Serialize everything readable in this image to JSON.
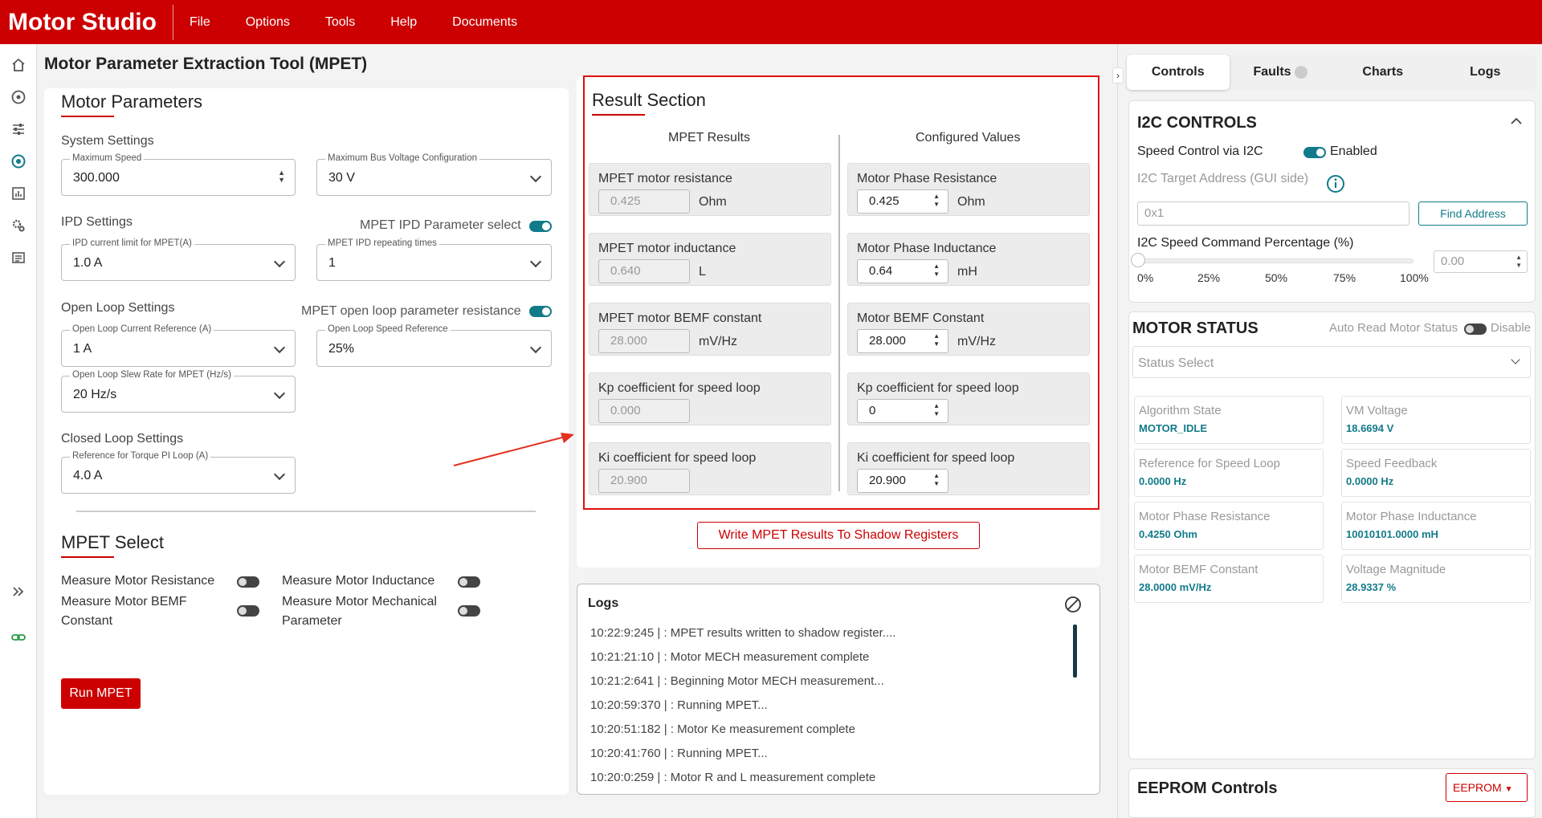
{
  "app": {
    "brand": "Motor Studio",
    "menu": [
      "File",
      "Options",
      "Tools",
      "Help",
      "Documents"
    ]
  },
  "page_title": "Motor Parameter Extraction Tool (MPET)",
  "motor_params": {
    "title": "Motor Parameters",
    "system_settings": "System Settings",
    "max_speed": {
      "label": "Maximum Speed",
      "value": "300.000"
    },
    "max_bus_voltage": {
      "label": "Maximum Bus Voltage Configuration",
      "value": "30 V"
    },
    "ipd_settings": "IPD Settings",
    "ipd_param_select": "MPET IPD Parameter select",
    "ipd_current": {
      "label": "IPD current limit for MPET(A)",
      "value": "1.0 A"
    },
    "ipd_repeat": {
      "label": "MPET IPD repeating times",
      "value": "1"
    },
    "open_loop_settings": "Open Loop Settings",
    "ol_param_res": "MPET open loop parameter resistance",
    "ol_current": {
      "label": "Open Loop Current Reference (A)",
      "value": "1 A"
    },
    "ol_speed": {
      "label": "Open Loop Speed Reference",
      "value": "25%"
    },
    "ol_slew": {
      "label": "Open Loop Slew Rate for MPET (Hz/s)",
      "value": "20 Hz/s"
    },
    "closed_loop_settings": "Closed Loop Settings",
    "torque_pi": {
      "label": "Reference for Torque PI Loop (A)",
      "value": "4.0 A"
    }
  },
  "mpet_select": {
    "title": "MPET Select",
    "items": [
      "Measure Motor Resistance",
      "Measure Motor Inductance",
      "Measure Motor BEMF Constant",
      "Measure Motor Mechanical Parameter"
    ],
    "run_button": "Run MPET"
  },
  "result": {
    "title": "Result Section",
    "col_left": "MPET Results",
    "col_right": "Configured Values",
    "left": [
      {
        "label": "MPET motor resistance",
        "value": "0.425",
        "unit": "Ohm"
      },
      {
        "label": "MPET motor inductance",
        "value": "0.640",
        "unit": "L"
      },
      {
        "label": "MPET motor BEMF constant",
        "value": "28.000",
        "unit": "mV/Hz"
      },
      {
        "label": "Kp coefficient for speed loop",
        "value": "0.000",
        "unit": ""
      },
      {
        "label": "Ki coefficient for speed loop",
        "value": "20.900",
        "unit": ""
      }
    ],
    "right": [
      {
        "label": "Motor Phase Resistance",
        "value": "0.425",
        "unit": "Ohm"
      },
      {
        "label": "Motor Phase Inductance",
        "value": "0.64",
        "unit": "mH"
      },
      {
        "label": "Motor BEMF Constant",
        "value": "28.000",
        "unit": "mV/Hz"
      },
      {
        "label": "Kp coefficient for speed loop",
        "value": "0",
        "unit": ""
      },
      {
        "label": "Ki coefficient for speed loop",
        "value": "20.900",
        "unit": ""
      }
    ],
    "write_button": "Write MPET Results To Shadow Registers"
  },
  "logs": {
    "title": "Logs",
    "lines": [
      "10:22:9:245 | : MPET results written to shadow register....",
      "10:21:21:10 | : Motor MECH measurement complete",
      "10:21:2:641 | : Beginning Motor MECH measurement...",
      "10:20:59:370 | : Running MPET...",
      "10:20:51:182 | : Motor Ke measurement complete",
      "10:20:41:760 | : Running MPET...",
      "10:20:0:259 | : Motor R and L measurement complete"
    ]
  },
  "right_panel": {
    "tabs": [
      "Controls",
      "Faults",
      "Charts",
      "Logs"
    ],
    "i2c": {
      "title": "I2C CONTROLS",
      "speed_ctrl": "Speed Control via I2C",
      "enabled": "Enabled",
      "target_addr_label": "I2C Target Address (GUI side)",
      "target_addr_value": "0x1",
      "find_button": "Find Address",
      "pct_label": "I2C Speed Command Percentage (%)",
      "pct_value": "0.00",
      "ticks": [
        "0%",
        "25%",
        "50%",
        "75%",
        "100%"
      ],
      "slider_level": 0
    },
    "motor_status": {
      "title": "MOTOR STATUS",
      "auto_read": "Auto Read Motor Status",
      "disable": "Disable",
      "select_placeholder": "Status Select",
      "items": [
        {
          "k": "Algorithm State",
          "v": "MOTOR_IDLE"
        },
        {
          "k": "VM Voltage",
          "v": "18.6694 V"
        },
        {
          "k": "Reference for Speed Loop",
          "v": "0.0000 Hz"
        },
        {
          "k": "Speed Feedback",
          "v": "0.0000 Hz"
        },
        {
          "k": "Motor Phase Resistance",
          "v": "0.4250 Ohm"
        },
        {
          "k": "Motor Phase Inductance",
          "v": "10010101.0000 mH"
        },
        {
          "k": "Motor BEMF Constant",
          "v": "28.0000 mV/Hz"
        },
        {
          "k": "Voltage Magnitude",
          "v": "28.9337 %"
        }
      ]
    },
    "eeprom": {
      "title": "EEPROM Controls",
      "button": "EEPROM"
    }
  }
}
